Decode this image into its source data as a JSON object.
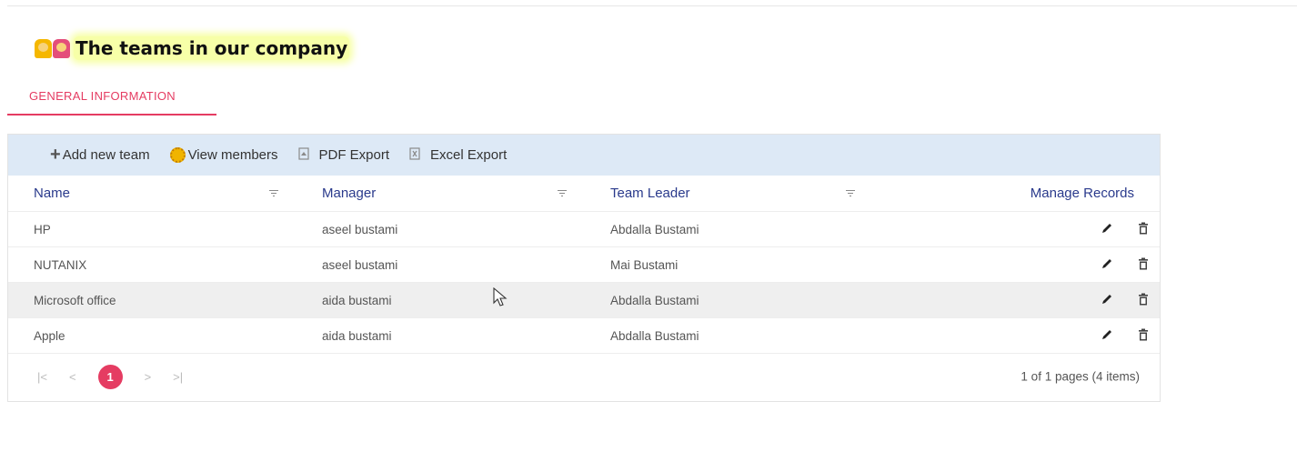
{
  "page": {
    "title": "The teams in our company",
    "title_icon": "two-people-emoji-icon"
  },
  "tabs": [
    {
      "label": "GENERAL INFORMATION",
      "active": true
    }
  ],
  "toolbar": {
    "add_label": "Add new team",
    "view_members_label": "View members",
    "pdf_label": "PDF Export",
    "excel_label": "Excel Export"
  },
  "columns": {
    "name": "Name",
    "manager": "Manager",
    "team_leader": "Team Leader",
    "manage": "Manage Records"
  },
  "rows": [
    {
      "name": "HP",
      "manager": "aseel bustami",
      "team_leader": "Abdalla Bustami"
    },
    {
      "name": "NUTANIX",
      "manager": "aseel bustami",
      "team_leader": "Mai Bustami"
    },
    {
      "name": "Microsoft office",
      "manager": "aida bustami",
      "team_leader": "Abdalla Bustami"
    },
    {
      "name": "Apple",
      "manager": "aida bustami",
      "team_leader": "Abdalla Bustami"
    }
  ],
  "pager": {
    "current_page": "1",
    "info": "1 of 1 pages (4 items)"
  },
  "colors": {
    "accent": "#e53c62",
    "toolbar_bg": "#dde9f6",
    "header_text": "#2a3a8c",
    "title_highlight": "#f7ffa8"
  }
}
